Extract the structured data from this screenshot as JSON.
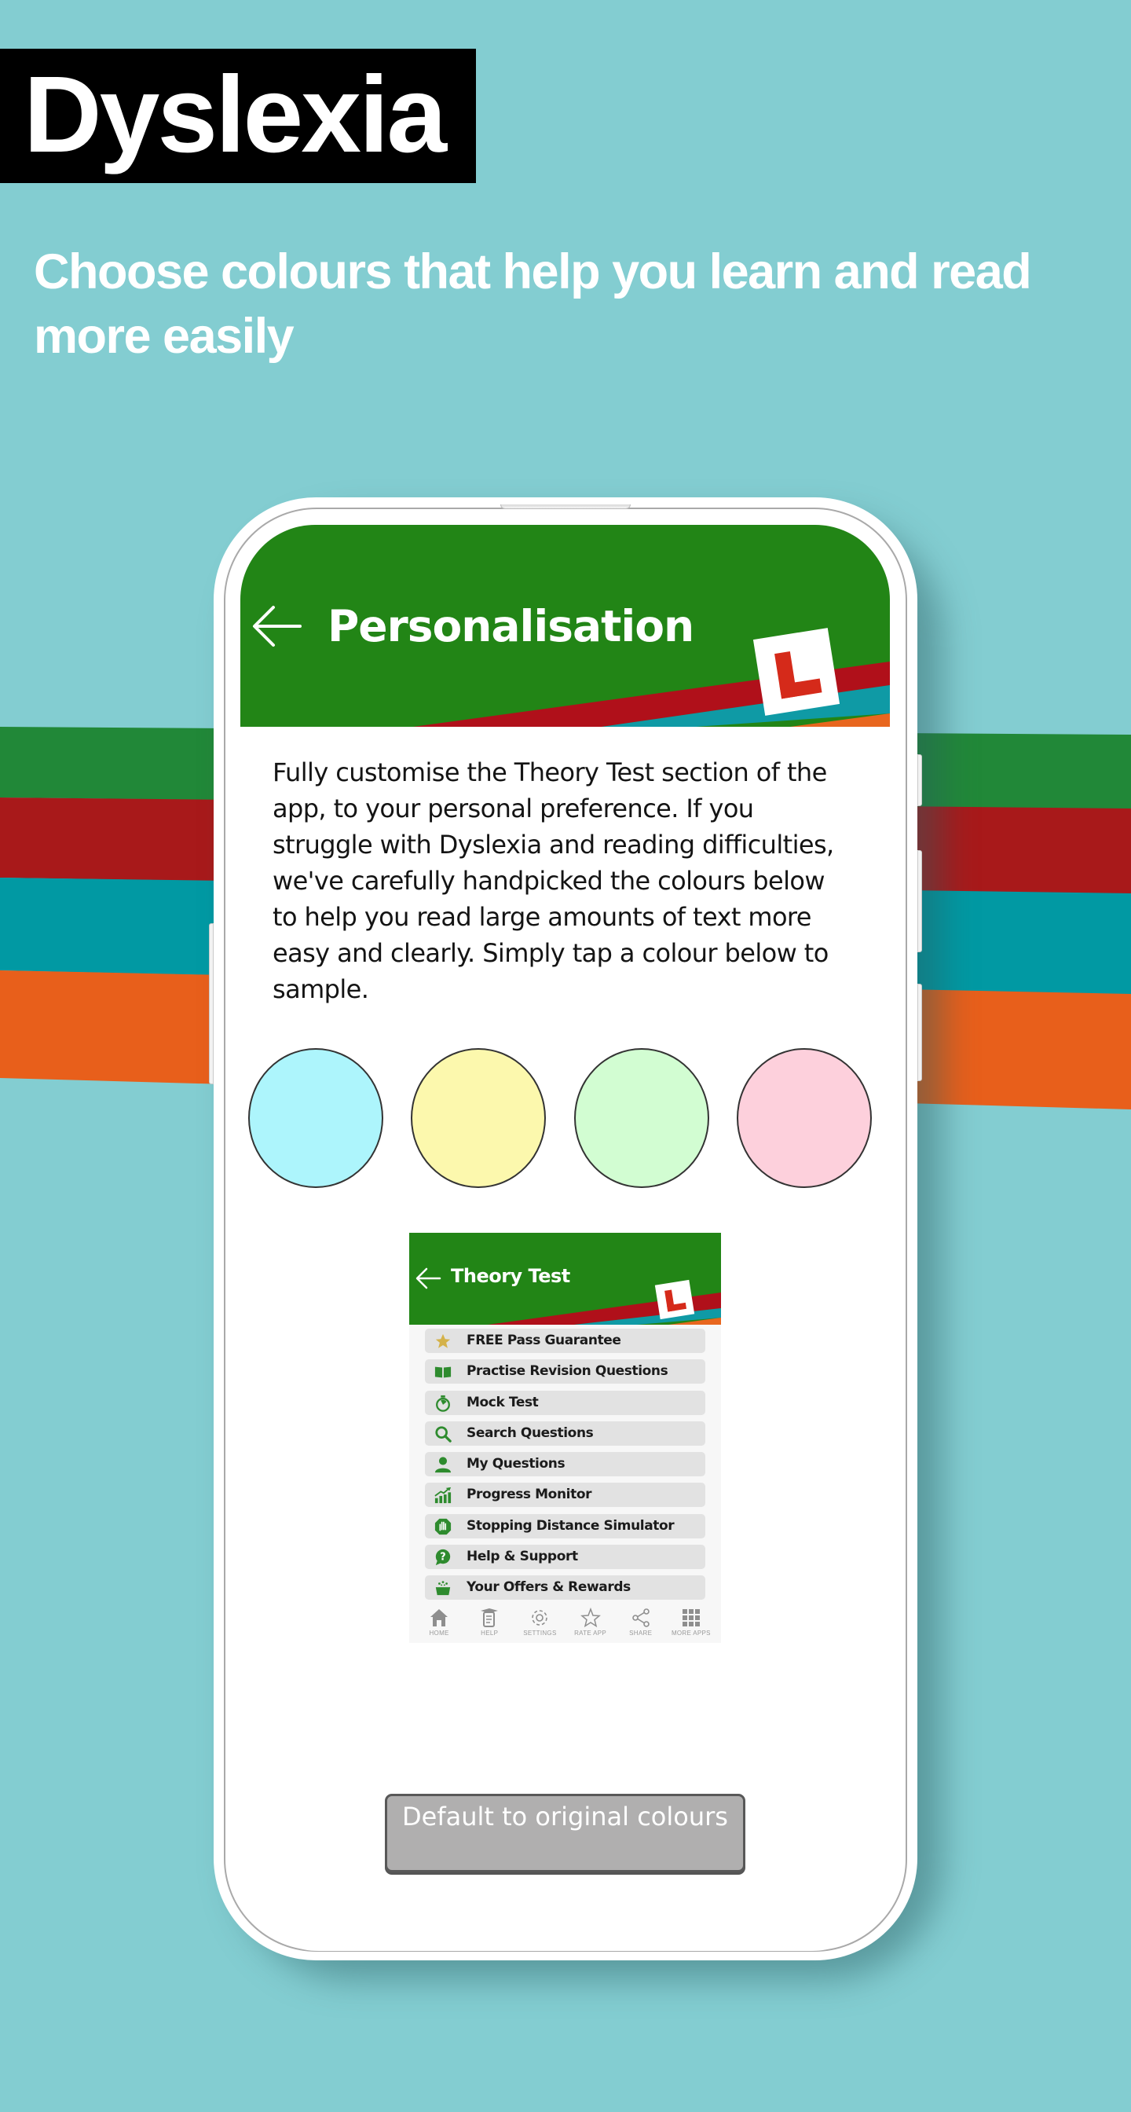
{
  "promo": {
    "title": "Dyslexia",
    "subtitle": "Choose colours that help you learn and read more easily",
    "background_color": "#83cdd1",
    "stripe_colors": [
      "#218838",
      "#a8191a",
      "#0199a3",
      "#e85f1b"
    ]
  },
  "app": {
    "header": {
      "back_icon": "arrow-left-icon",
      "title": "Personalisation",
      "logo": "l-plate-logo",
      "brand_green": "#228516",
      "band_colors": [
        "#b0101a",
        "#0f9aa5",
        "#e8661e"
      ]
    },
    "intro_text": "Fully customise the Theory Test section of the app, to your personal preference. If you struggle with Dyslexia and reading difficulties, we've carefully handpicked the colours below to help you read large amounts of text more easy and clearly. Simply tap a colour below to sample.",
    "swatches": [
      {
        "name": "light-blue",
        "color": "#adf5fc"
      },
      {
        "name": "light-yellow",
        "color": "#fcf8ad"
      },
      {
        "name": "light-green",
        "color": "#d2fdd2"
      },
      {
        "name": "light-pink",
        "color": "#fdd0dc"
      }
    ],
    "preview": {
      "title": "Theory Test",
      "menu": [
        {
          "label": "FREE Pass Guarantee",
          "icon": "star-icon"
        },
        {
          "label": "Practise Revision Questions",
          "icon": "book-icon"
        },
        {
          "label": "Mock Test",
          "icon": "stopwatch-icon"
        },
        {
          "label": "Search Questions",
          "icon": "search-icon"
        },
        {
          "label": "My Questions",
          "icon": "user-icon"
        },
        {
          "label": "Progress Monitor",
          "icon": "chart-up-icon"
        },
        {
          "label": "Stopping Distance Simulator",
          "icon": "hand-stop-icon"
        },
        {
          "label": "Help & Support",
          "icon": "question-icon"
        },
        {
          "label": "Your Offers & Rewards",
          "icon": "gift-icon"
        }
      ],
      "nav": [
        {
          "label": "HOME",
          "icon": "home-icon"
        },
        {
          "label": "HELP",
          "icon": "help-book-icon"
        },
        {
          "label": "SETTINGS",
          "icon": "gear-icon"
        },
        {
          "label": "RATE APP",
          "icon": "star-outline-icon"
        },
        {
          "label": "SHARE",
          "icon": "share-icon"
        },
        {
          "label": "MORE APPS",
          "icon": "grid-icon"
        }
      ]
    },
    "default_button": "Default to original colours"
  }
}
